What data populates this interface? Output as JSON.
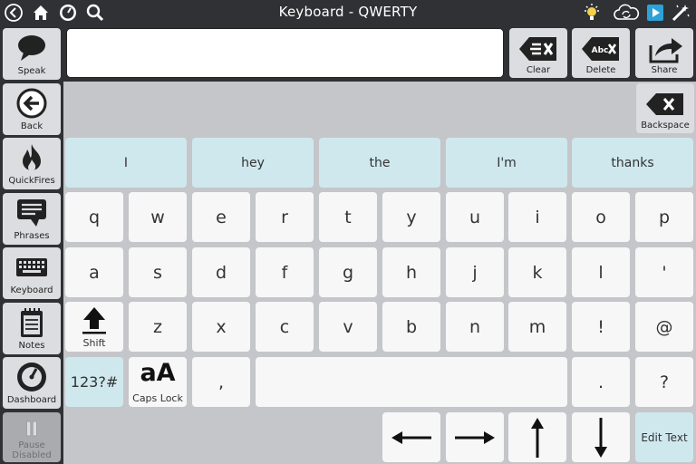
{
  "app": {
    "title": "Keyboard - QWERTY"
  },
  "toolbar": {
    "clear_label": "Clear",
    "delete_label": "Delete",
    "share_label": "Share",
    "delete_icon_text": "Abc",
    "backspace_label": "Backspace"
  },
  "sidebar": {
    "items": [
      {
        "label": "Speak"
      },
      {
        "label": "Back"
      },
      {
        "label": "QuickFires"
      },
      {
        "label": "Phrases"
      },
      {
        "label": "Keyboard"
      },
      {
        "label": "Notes"
      },
      {
        "label": "Dashboard"
      },
      {
        "label1": "Pause",
        "label2": "Disabled"
      }
    ]
  },
  "predictions": [
    "I",
    "hey",
    "the",
    "I'm",
    "thanks"
  ],
  "keys": {
    "row1": [
      "q",
      "w",
      "e",
      "r",
      "t",
      "y",
      "u",
      "i",
      "o",
      "p"
    ],
    "row2": [
      "a",
      "s",
      "d",
      "f",
      "g",
      "h",
      "j",
      "k",
      "l",
      "'"
    ],
    "row3": [
      "z",
      "x",
      "c",
      "v",
      "b",
      "n",
      "m",
      "!",
      "@"
    ],
    "shift_label": "Shift",
    "numbers_label": "123?#",
    "caps_icon": "aA",
    "caps_label": "Caps Lock",
    "comma": ",",
    "period": ".",
    "question": "?",
    "edit_label": "Edit Text"
  },
  "colors": {
    "bar": "#2f3134",
    "key": "#f7f7f8",
    "accent": "#cfe8ee"
  }
}
